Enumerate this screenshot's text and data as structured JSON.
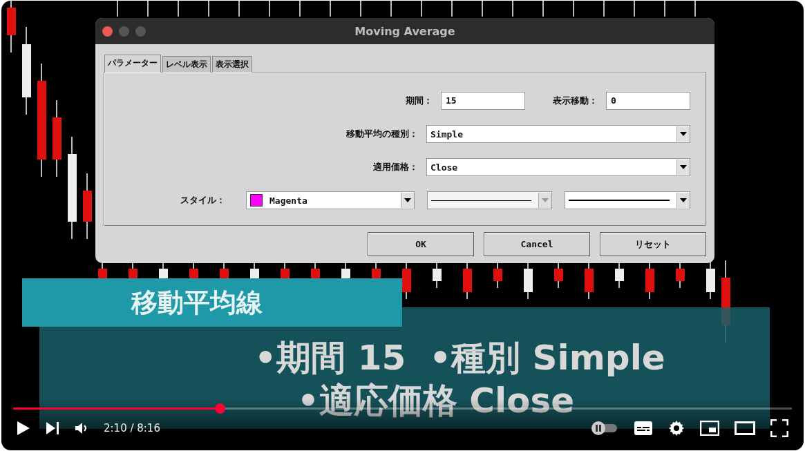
{
  "video": {
    "dialog": {
      "title": "Moving Average",
      "tabs": [
        {
          "label": "パラメーター",
          "selected": true
        },
        {
          "label": "レベル表示",
          "selected": false
        },
        {
          "label": "表示選択",
          "selected": false
        }
      ],
      "period": {
        "label": "期間：",
        "value": "15"
      },
      "shift": {
        "label": "表示移動：",
        "value": "0"
      },
      "method": {
        "label": "移動平均の種別：",
        "value": "Simple"
      },
      "price": {
        "label": "適用価格：",
        "value": "Close"
      },
      "style": {
        "label": "スタイル：",
        "color": {
          "name": "Magenta",
          "color": "#ff00ff"
        },
        "line_style": {
          "disabled": true
        },
        "line_width": {
          "disabled": false
        }
      },
      "buttons": [
        "OK",
        "Cancel",
        "リセット"
      ]
    },
    "captions": {
      "heading": "移動平均線",
      "rows": [
        [
          "•期間 15",
          "•種別 Simple"
        ],
        [
          "•適応価格 Close"
        ]
      ]
    }
  },
  "player": {
    "progress": {
      "level": 0.265
    },
    "time": "2:10 / 8:16",
    "autoplay": {
      "on": false
    }
  }
}
